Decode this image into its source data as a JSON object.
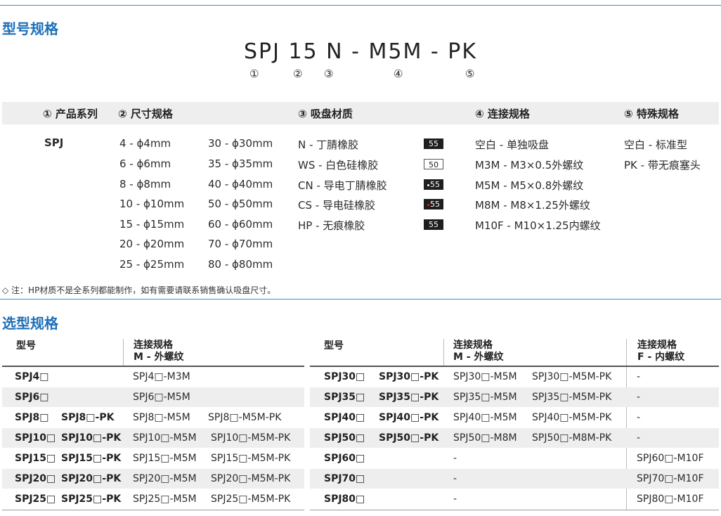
{
  "section1": {
    "title": "型号规格"
  },
  "model_code": {
    "text": "SPJ 15 N - M5M - PK",
    "markers": [
      "①",
      "②",
      "③",
      "④",
      "⑤"
    ]
  },
  "spec_headers": [
    "① 产品系列",
    "② 尺寸规格",
    "③ 吸盘材质",
    "④ 连接规格",
    "⑤ 特殊规格"
  ],
  "product_series": "SPJ",
  "sizes_col1": [
    "4  - ϕ4mm",
    "6  - ϕ6mm",
    "8  - ϕ8mm",
    "10 - ϕ10mm",
    "15 - ϕ15mm",
    "20 - ϕ20mm",
    "25 - ϕ25mm"
  ],
  "sizes_col2": [
    "30 - ϕ30mm",
    "35 - ϕ35mm",
    "40 - ϕ40mm",
    "50 - ϕ50mm",
    "60 - ϕ60mm",
    "70 - ϕ70mm",
    "80 - ϕ80mm"
  ],
  "materials": [
    {
      "label": "N   - 丁腈橡胶",
      "badge": "55",
      "style": "dark",
      "dot": ""
    },
    {
      "label": "WS - 白色硅橡胶",
      "badge": "50",
      "style": "light",
      "dot": ""
    },
    {
      "label": "CN - 导电丁腈橡胶",
      "badge": "55",
      "style": "dark",
      "dot": "#ffffff"
    },
    {
      "label": "CS  - 导电硅橡胶",
      "badge": "55",
      "style": "dark",
      "dot": "#e02020"
    },
    {
      "label": "HP - 无痕橡胶",
      "badge": "55",
      "style": "dark",
      "dot": ""
    }
  ],
  "connections": [
    "空白  - 单独吸盘",
    "M3M  - M3×0.5外螺纹",
    "M5M  - M5×0.8外螺纹",
    "M8M  - M8×1.25外螺纹",
    "M10F - M10×1.25内螺纹"
  ],
  "specials": [
    "空白 - 标准型",
    "PK   - 带无痕塞头"
  ],
  "note": "◇ 注：HP材质不是全系列都能制作，如有需要请联系销售确认吸盘尺寸。",
  "section2": {
    "title": "选型规格"
  },
  "left_table": {
    "headers": {
      "model": "型号",
      "conn_line1": "连接规格",
      "conn_line2": "M - 外螺纹"
    },
    "rows": [
      {
        "m1": "SPJ4□",
        "m2": "",
        "c1": "SPJ4□-M3M",
        "c2": ""
      },
      {
        "m1": "SPJ6□",
        "m2": "",
        "c1": "SPJ6□-M5M",
        "c2": ""
      },
      {
        "m1": "SPJ8□",
        "m2": "SPJ8□-PK",
        "c1": "SPJ8□-M5M",
        "c2": "SPJ8□-M5M-PK"
      },
      {
        "m1": "SPJ10□",
        "m2": "SPJ10□-PK",
        "c1": "SPJ10□-M5M",
        "c2": "SPJ10□-M5M-PK"
      },
      {
        "m1": "SPJ15□",
        "m2": "SPJ15□-PK",
        "c1": "SPJ15□-M5M",
        "c2": "SPJ15□-M5M-PK"
      },
      {
        "m1": "SPJ20□",
        "m2": "SPJ20□-PK",
        "c1": "SPJ20□-M5M",
        "c2": "SPJ20□-M5M-PK"
      },
      {
        "m1": "SPJ25□",
        "m2": "SPJ25□-PK",
        "c1": "SPJ25□-M5M",
        "c2": "SPJ25□-M5M-PK"
      }
    ]
  },
  "right_table": {
    "headers": {
      "model": "型号",
      "conn_line1": "连接规格",
      "conn_line2": "M - 外螺纹",
      "f_line1": "连接规格",
      "f_line2": "F - 内螺纹"
    },
    "rows": [
      {
        "m1": "SPJ30□",
        "m2": "SPJ30□-PK",
        "c1": "SPJ30□-M5M",
        "c2": "SPJ30□-M5M-PK",
        "f": "-"
      },
      {
        "m1": "SPJ35□",
        "m2": "SPJ35□-PK",
        "c1": "SPJ35□-M5M",
        "c2": "SPJ35□-M5M-PK",
        "f": "-"
      },
      {
        "m1": "SPJ40□",
        "m2": "SPJ40□-PK",
        "c1": "SPJ40□-M5M",
        "c2": "SPJ40□-M5M-PK",
        "f": "-"
      },
      {
        "m1": "SPJ50□",
        "m2": "SPJ50□-PK",
        "c1": "SPJ50□-M8M",
        "c2": "SPJ50□-M8M-PK",
        "f": "-"
      },
      {
        "m1": "SPJ60□",
        "m2": "",
        "c1": "-",
        "c2": "",
        "f": "SPJ60□-M10F"
      },
      {
        "m1": "SPJ70□",
        "m2": "",
        "c1": "-",
        "c2": "",
        "f": "SPJ70□-M10F"
      },
      {
        "m1": "SPJ80□",
        "m2": "",
        "c1": "-",
        "c2": "",
        "f": "SPJ80□-M10F"
      }
    ]
  }
}
